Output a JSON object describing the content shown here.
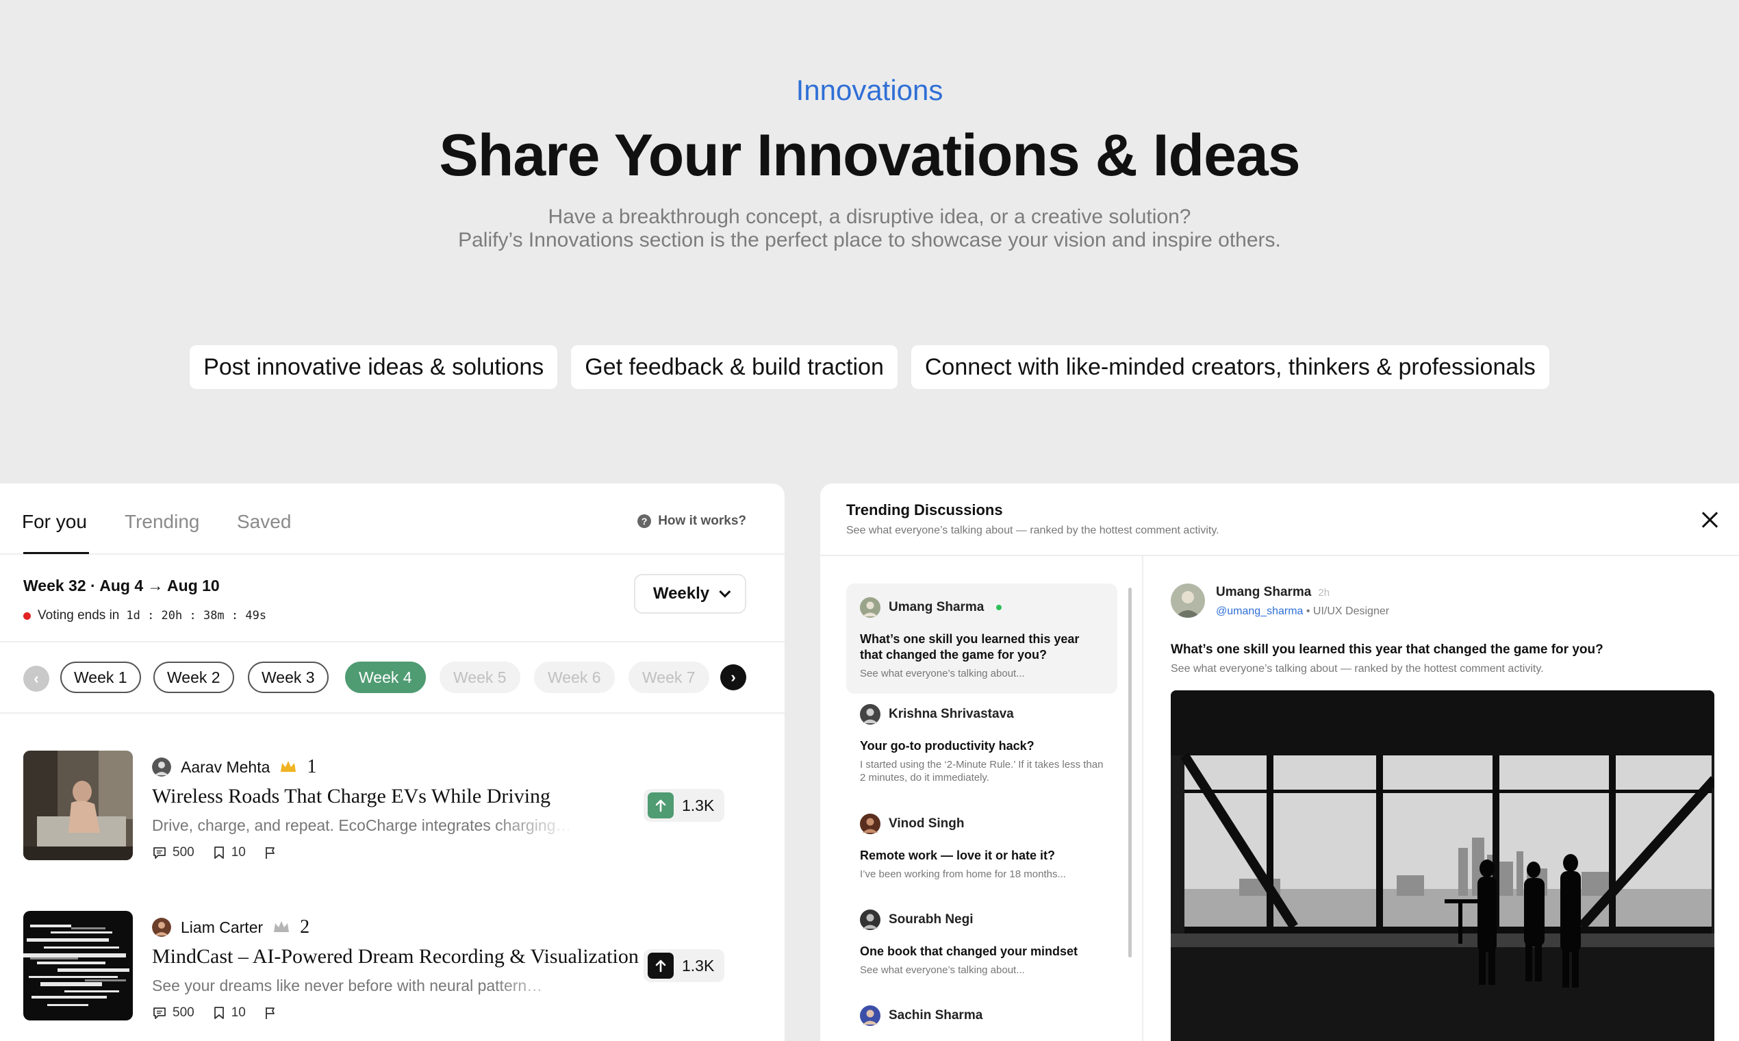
{
  "hero": {
    "eyebrow": "Innovations",
    "title": "Share Your Innovations & Ideas",
    "subtitle_line1": "Have a breakthrough concept, a disruptive idea, or a creative solution?",
    "subtitle_line2": "Palify’s Innovations section is the perfect place to showcase your vision and inspire others.",
    "features": [
      "Post innovative ideas & solutions",
      "Get feedback & build traction",
      "Connect with like-minded creators, thinkers & professionals"
    ]
  },
  "feed": {
    "tabs": [
      "For you",
      "Trending",
      "Saved"
    ],
    "active_tab": "For you",
    "how_it_works": "How it works?",
    "week_title": "Week 32 · Aug 4 → Aug 10",
    "voting_label": "Voting ends in",
    "countdown": "1d : 20h : 38m : 49s",
    "period_select": "Weekly",
    "weeks": [
      "Week 1",
      "Week 2",
      "Week 3",
      "Week 4",
      "Week 5",
      "Week 6",
      "Week 7"
    ],
    "current_week": "Week 4",
    "accent_color": "#4f9b72",
    "ideas": [
      {
        "author": "Aarav Mehta",
        "rank": "1",
        "rank_icon": "gold-crown-icon",
        "title": "Wireless Roads That Charge EVs While Driving",
        "description": "Drive, charge, and repeat. EcoCharge integrates charging…",
        "comments": "500",
        "saves": "10",
        "votes": "1.3K",
        "voted": true
      },
      {
        "author": "Liam Carter",
        "rank": "2",
        "rank_icon": "silver-crown-icon",
        "title": "MindCast – AI-Powered Dream Recording & Visualization",
        "description": "See your dreams like never before with neural pattern…",
        "comments": "500",
        "saves": "10",
        "votes": "1.3K",
        "voted": false
      }
    ]
  },
  "discussions": {
    "title": "Trending Discussions",
    "subtitle": "See what everyone’s talking about — ranked by the hottest comment activity.",
    "items": [
      {
        "author": "Umang Sharma",
        "online": true,
        "question": "What’s one skill you learned this year that changed the game for you?",
        "preview": "See what everyone’s talking about..."
      },
      {
        "author": "Krishna Shrivastava",
        "online": false,
        "question": "Your go-to productivity hack?",
        "preview": "I started using the ‘2-Minute Rule.’ If it takes less than 2 minutes, do it immediately."
      },
      {
        "author": "Vinod Singh",
        "online": false,
        "question": "Remote work — love it or hate it?",
        "preview": "I’ve been working from home for 18 months..."
      },
      {
        "author": "Sourabh Negi",
        "online": false,
        "question": "One book that changed your mindset",
        "preview": "See what everyone’s talking about..."
      },
      {
        "author": "Sachin Sharma",
        "online": false,
        "question": "",
        "preview": ""
      }
    ],
    "detail": {
      "author": "Umang Sharma",
      "time": "2h",
      "handle": "@umang_sharma",
      "role": "• UI/UX Designer",
      "question": "What’s one skill you learned this year that changed the game for you?",
      "subtitle": "See what everyone’s talking about — ranked by the hottest comment activity."
    }
  }
}
